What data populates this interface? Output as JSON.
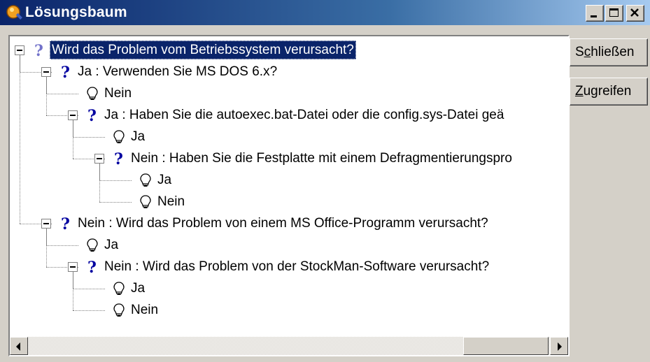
{
  "window": {
    "title": "Lösungsbaum",
    "controls": [
      "minimize",
      "maximize",
      "close"
    ]
  },
  "buttons": {
    "close": {
      "before": "S",
      "accel": "c",
      "after": "hließen"
    },
    "access": {
      "before": "",
      "accel": "Z",
      "after": "ugreifen"
    }
  },
  "tree": {
    "selected_color": "#0a246a",
    "nodes": [
      {
        "icon": "question-icon",
        "label": "Wird das Problem vom Betriebssystem verursacht?"
      },
      {
        "icon": "question-icon",
        "label": "Ja : Verwenden Sie MS DOS 6.x?"
      },
      {
        "icon": "lightbulb-icon",
        "label": "Nein"
      },
      {
        "icon": "question-icon",
        "label": "Ja : Haben Sie die autoexec.bat-Datei oder die config.sys-Datei geä"
      },
      {
        "icon": "lightbulb-icon",
        "label": "Ja"
      },
      {
        "icon": "question-icon",
        "label": "Nein : Haben Sie die Festplatte mit einem Defragmentierungspro"
      },
      {
        "icon": "lightbulb-icon",
        "label": "Ja"
      },
      {
        "icon": "lightbulb-icon",
        "label": "Nein"
      },
      {
        "icon": "question-icon",
        "label": "Nein : Wird das Problem von einem MS Office-Programm verursacht?"
      },
      {
        "icon": "lightbulb-icon",
        "label": "Ja"
      },
      {
        "icon": "question-icon",
        "label": "Nein : Wird das Problem von der StockMan-Software verursacht?"
      },
      {
        "icon": "lightbulb-icon",
        "label": "Ja"
      },
      {
        "icon": "lightbulb-icon",
        "label": "Nein"
      }
    ]
  }
}
